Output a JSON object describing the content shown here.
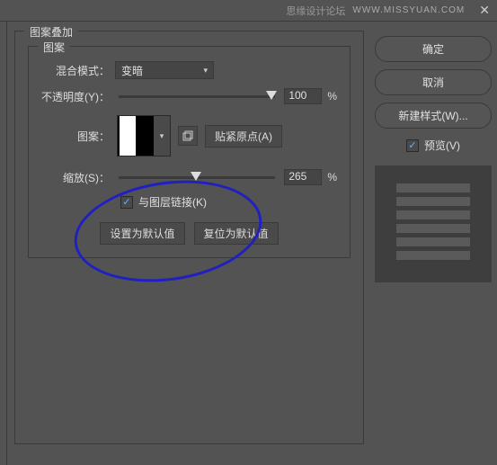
{
  "header": {
    "site_name": "思缘设计论坛",
    "site_url": "WWW.MISSYUAN.COM"
  },
  "panel": {
    "title": "图案叠加",
    "inner_title": "图案",
    "blend_mode_label": "混合模式：",
    "blend_mode_value": "变暗",
    "opacity_label": "不透明度(Y)：",
    "opacity_value": "100",
    "percent": "%",
    "pattern_label": "图案：",
    "snap_label": "贴紧原点(A)",
    "scale_label": "缩放(S)：",
    "scale_value": "265",
    "link_layer_label": "与图层链接(K)",
    "set_default": "设置为默认值",
    "reset_default": "复位为默认值"
  },
  "sidebar": {
    "ok": "确定",
    "cancel": "取消",
    "new_style": "新建样式(W)...",
    "preview": "预览(V)"
  }
}
